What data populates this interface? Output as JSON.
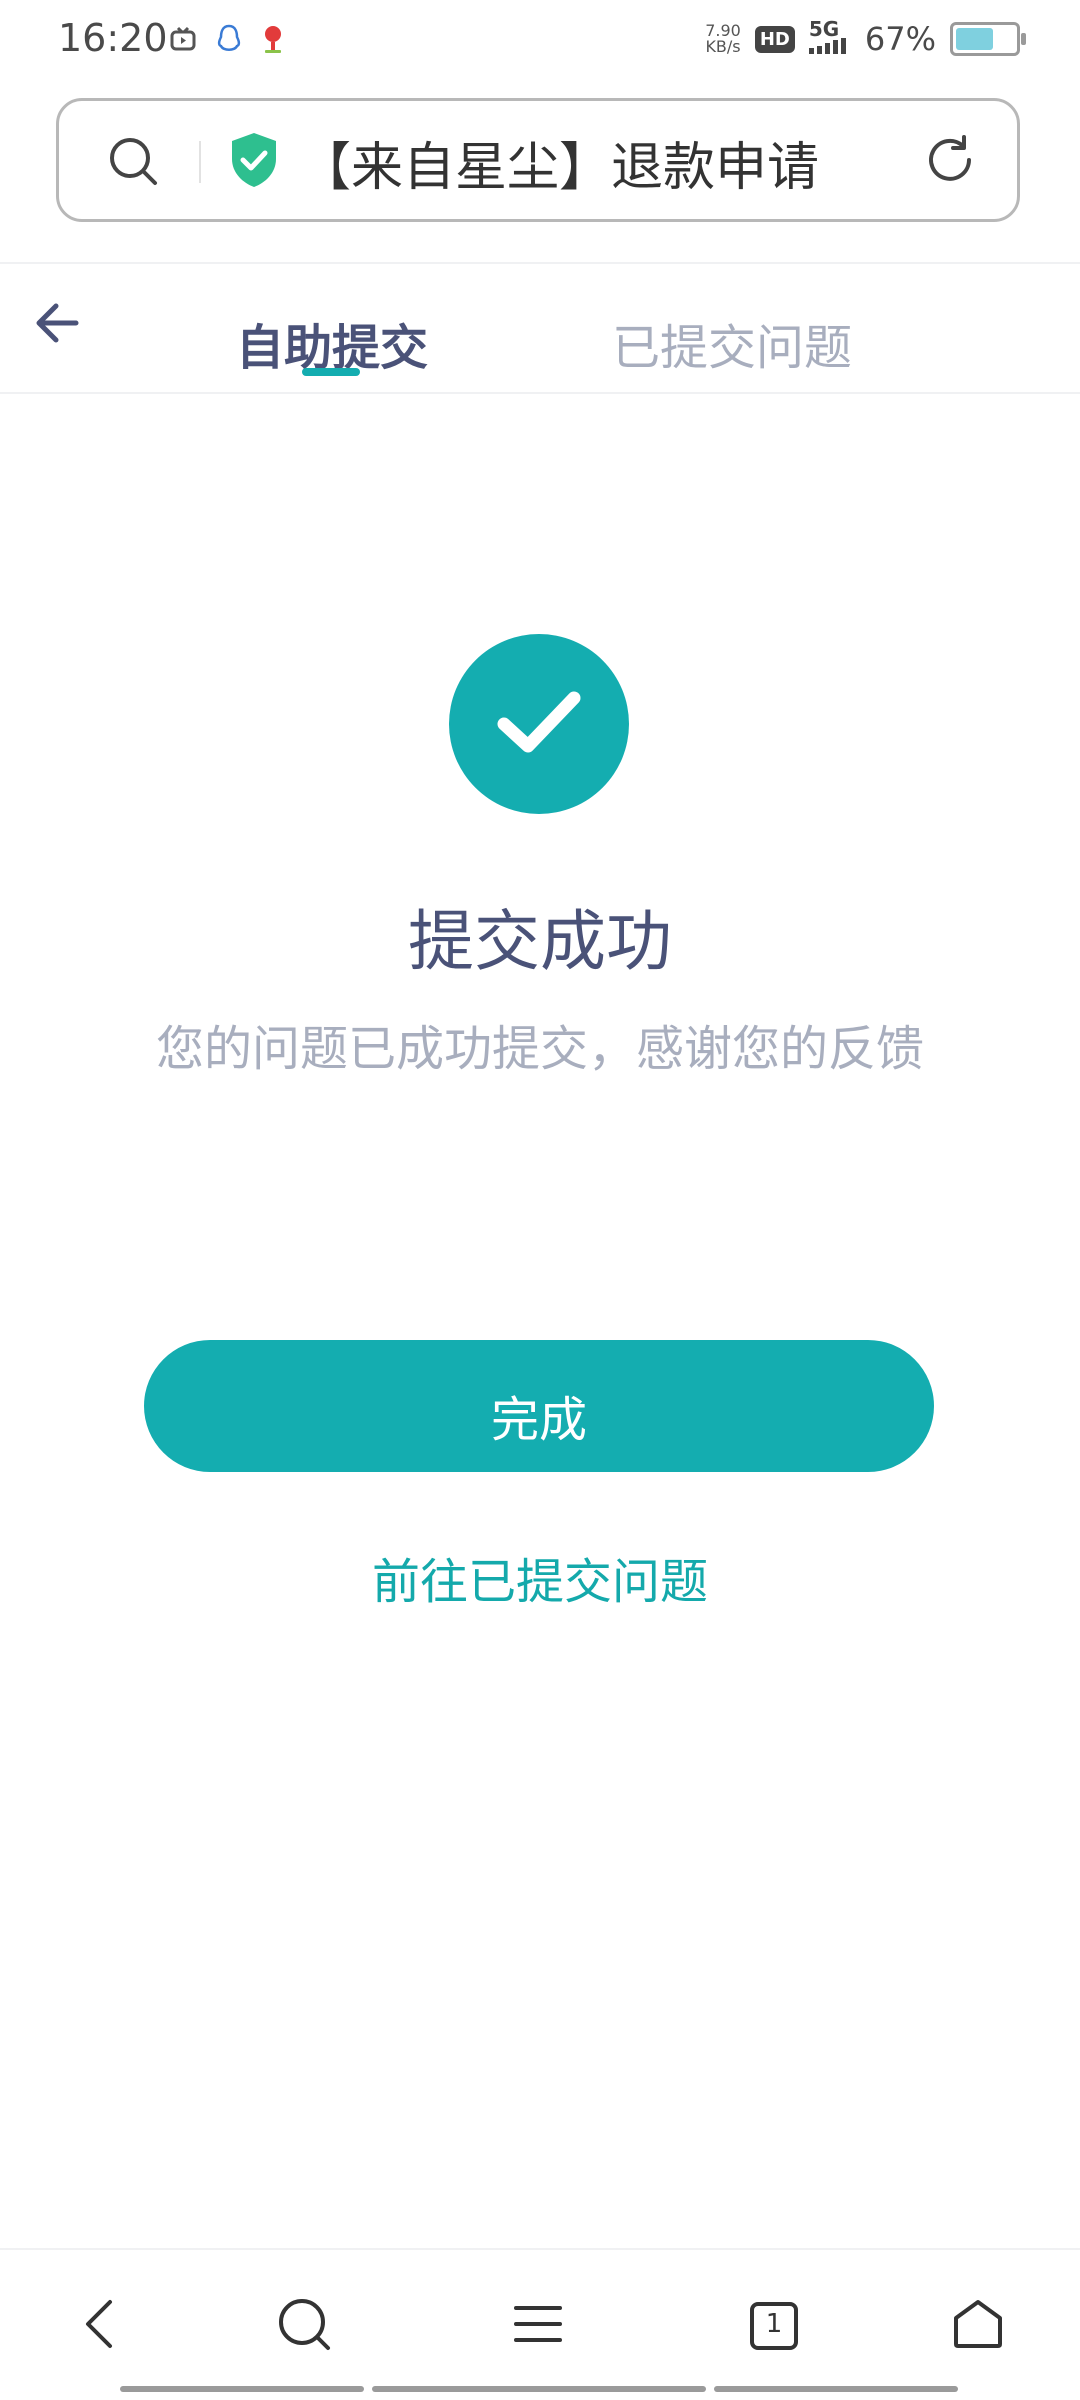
{
  "status_bar": {
    "time": "16:20",
    "net_speed_value": "7.90",
    "net_speed_unit": "KB/s",
    "hd_label": "HD",
    "network": "5G",
    "battery_percent": "67%",
    "battery_level": 0.67
  },
  "browser": {
    "page_title": "【来自星尘】退款申请"
  },
  "tabs": [
    {
      "label": "自助提交",
      "active": true
    },
    {
      "label": "已提交问题",
      "active": false
    }
  ],
  "success": {
    "title": "提交成功",
    "message": "您的问题已成功提交，感谢您的反馈"
  },
  "actions": {
    "done_label": "完成",
    "goto_submitted_label": "前往已提交问题"
  },
  "bottom_nav": {
    "tab_count": "1"
  },
  "colors": {
    "accent": "#14adb0",
    "heading": "#4a5278",
    "muted": "#a8aebe"
  }
}
